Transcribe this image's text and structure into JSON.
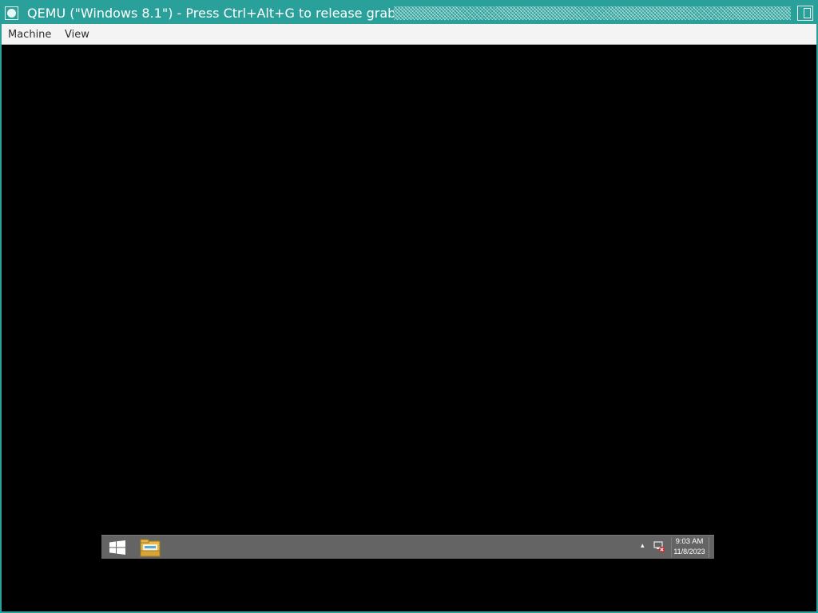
{
  "window": {
    "title": "QEMU (\"Windows 8.1\") - Press Ctrl+Alt+G to release grab"
  },
  "menubar": {
    "items": [
      {
        "label": "Machine"
      },
      {
        "label": "View"
      }
    ]
  },
  "guest": {
    "taskbar": {
      "pinned": [
        {
          "icon": "windows-logo-icon"
        },
        {
          "icon": "file-explorer-icon"
        }
      ],
      "tray": {
        "chevron": "▴",
        "network_icon": "network-disconnected-icon",
        "time": "9:03 AM",
        "date": "11/8/2023"
      }
    }
  },
  "colors": {
    "titlebar": "#2aa09a",
    "menubar": "#f4f4f4",
    "screen": "#000000",
    "taskbar": "#646464"
  }
}
